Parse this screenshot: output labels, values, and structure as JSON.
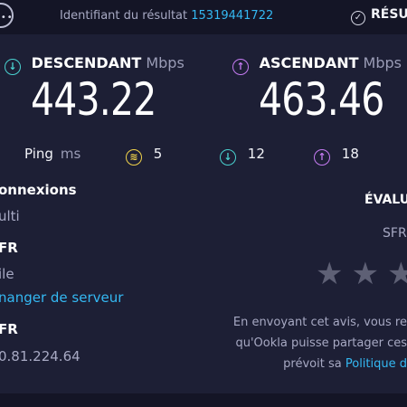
{
  "header": {
    "result_label": "Identifiant du résultat",
    "result_id": "15319441722",
    "results_button": "RÉSU"
  },
  "download": {
    "label": "DESCENDANT",
    "unit": "Mbps",
    "value": "443.22"
  },
  "upload": {
    "label": "ASCENDANT",
    "unit": "Mbps",
    "value": "463.46"
  },
  "ping": {
    "label": "Ping",
    "unit": "ms",
    "idle": "5",
    "down": "12",
    "up": "18"
  },
  "connections": {
    "title": "onnexions",
    "value": "ulti"
  },
  "isp": {
    "title": "FR",
    "value": "ile",
    "change_server": "nanger de serveur"
  },
  "server": {
    "title": "FR",
    "ip": "0.81.224.64"
  },
  "rating": {
    "title": "ÉVALU",
    "provider": "SFR",
    "stars": 3,
    "note_line1": "En envoyant cet avis, vous re",
    "note_line2": "qu'Ookla puisse partager ces",
    "note_line3": "prévoit sa",
    "policy_link": "Politique d"
  },
  "colors": {
    "background": "#1d1f35",
    "accent_link": "#34b8f2",
    "download": "#4ad2d0",
    "upload": "#c57bf2",
    "ping": "#f0d24a"
  }
}
